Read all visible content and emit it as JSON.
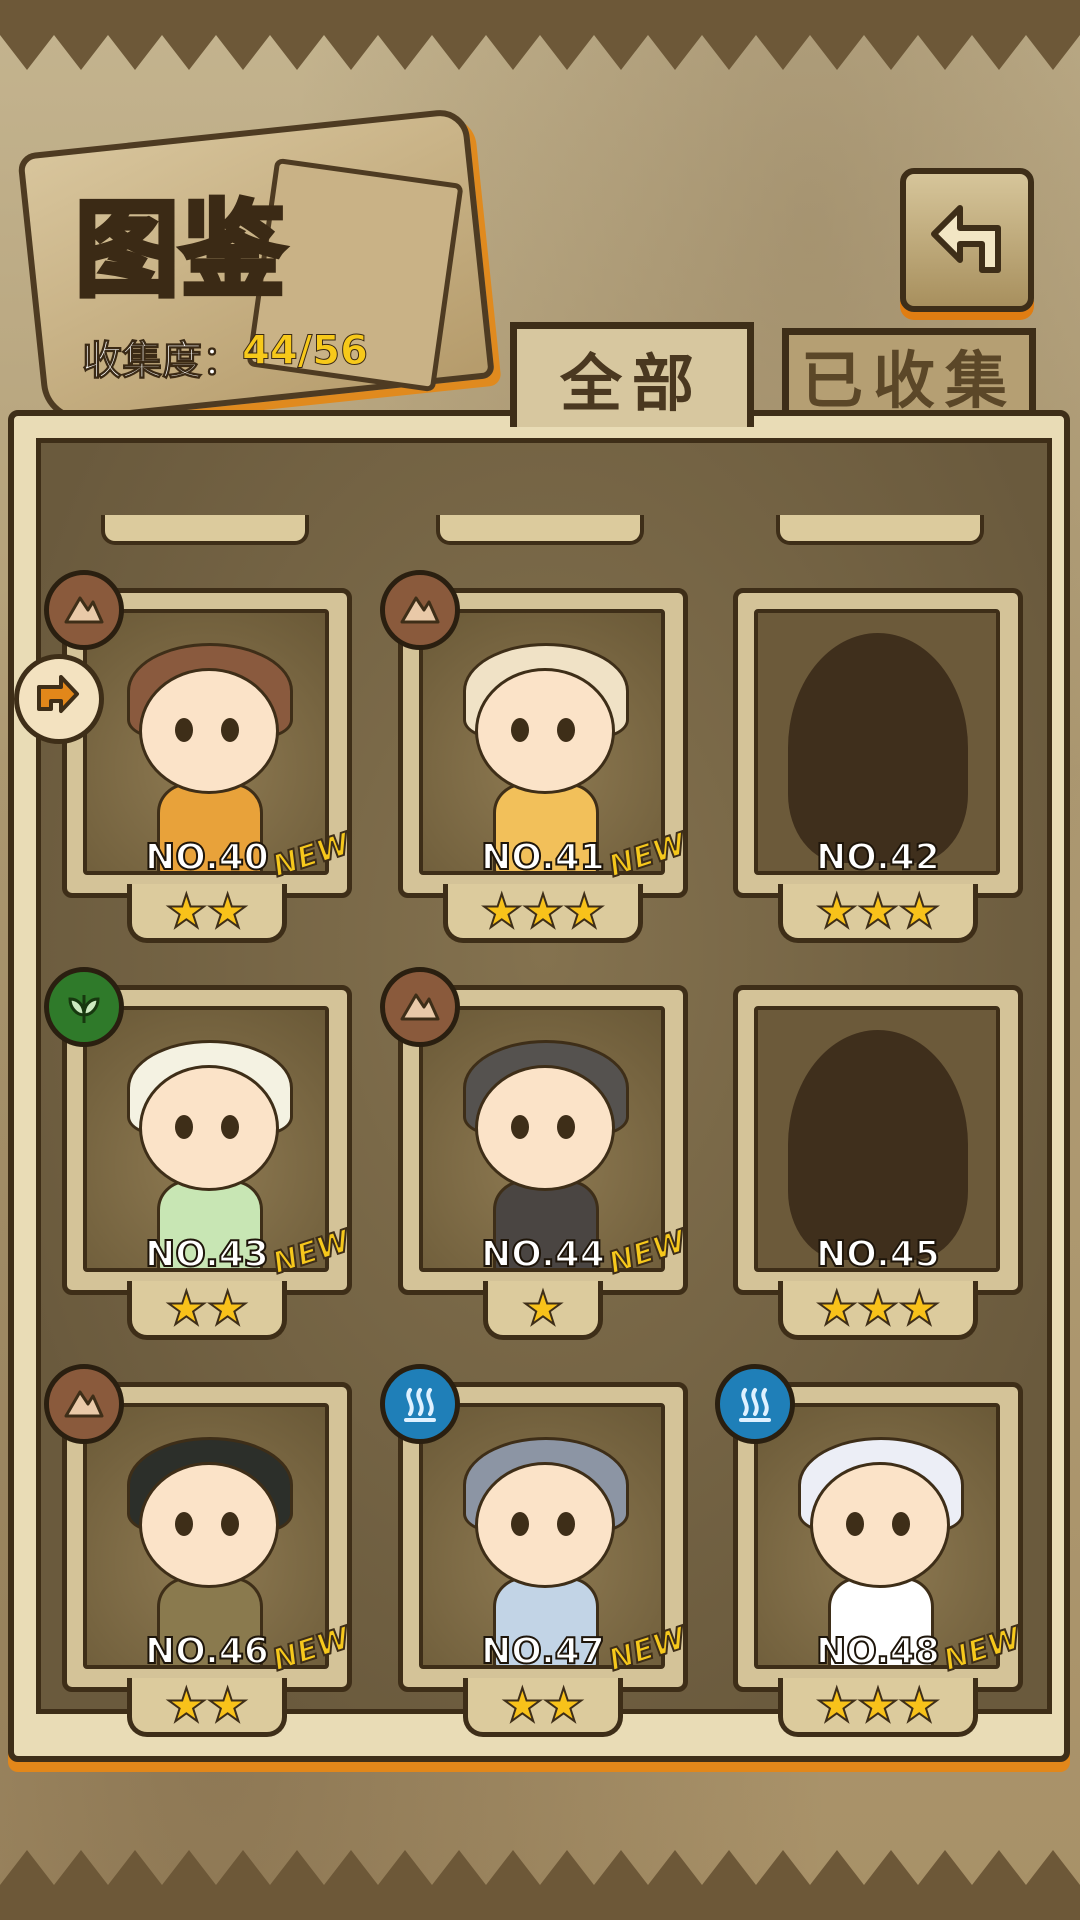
{
  "header": {
    "title": "图鉴",
    "collection_label": "收集度：",
    "collection_value": "44/56"
  },
  "tabs": [
    {
      "label": "全部",
      "active": true
    },
    {
      "label": "已收集",
      "active": false
    }
  ],
  "colors": {
    "earth": "#8a5a3c",
    "plant": "#2f7a2a",
    "water": "#1f7fb8",
    "star": "#f8c21a",
    "new": "#f6c81c"
  },
  "cards": [
    {
      "no": "NO.40",
      "stars": "★★",
      "new": "NEW",
      "element": "earth-icon",
      "hair": "#8a5a3e",
      "body": "#e8a23a",
      "silhouette": false
    },
    {
      "no": "NO.41",
      "stars": "★★★",
      "new": "NEW",
      "element": "earth-icon",
      "hair": "#f0e2c6",
      "body": "#f2c05a",
      "silhouette": false
    },
    {
      "no": "NO.42",
      "stars": "★★★",
      "new": "",
      "element": "",
      "hair": "",
      "body": "",
      "silhouette": true
    },
    {
      "no": "NO.43",
      "stars": "★★",
      "new": "NEW",
      "element": "plant-icon",
      "hair": "#f4f2e2",
      "body": "#c8e6b4",
      "silhouette": false
    },
    {
      "no": "NO.44",
      "stars": "★",
      "new": "NEW",
      "element": "earth-icon",
      "hair": "#55524f",
      "body": "#4a4542",
      "silhouette": false
    },
    {
      "no": "NO.45",
      "stars": "★★★",
      "new": "",
      "element": "",
      "hair": "",
      "body": "",
      "silhouette": true
    },
    {
      "no": "NO.46",
      "stars": "★★",
      "new": "NEW",
      "element": "earth-icon",
      "hair": "#2c2f2a",
      "body": "#8a7a4e",
      "silhouette": false
    },
    {
      "no": "NO.47",
      "stars": "★★",
      "new": "NEW",
      "element": "water-icon",
      "hair": "#8c95a4",
      "body": "#c2d4e6",
      "silhouette": false
    },
    {
      "no": "NO.48",
      "stars": "★★★",
      "new": "NEW",
      "element": "water-icon",
      "hair": "#eceef6",
      "body": "#ffffff",
      "silhouette": false
    }
  ]
}
